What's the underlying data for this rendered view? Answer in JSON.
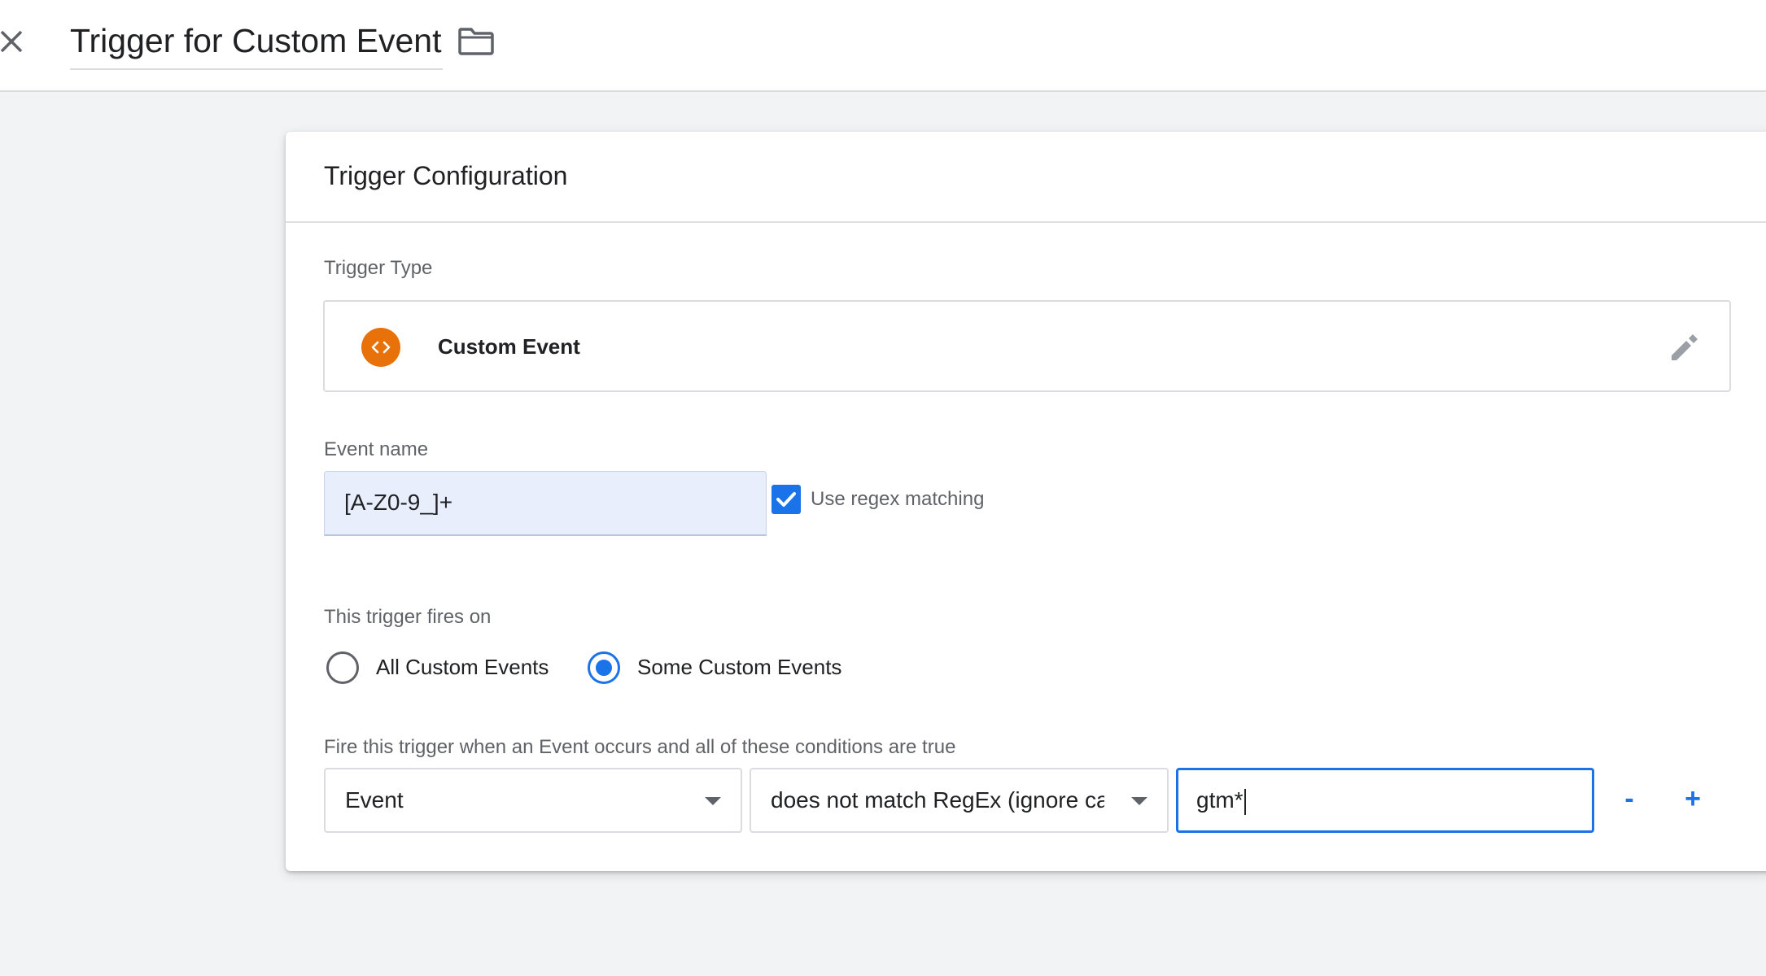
{
  "header": {
    "title": "Trigger for Custom Event"
  },
  "card": {
    "title": "Trigger Configuration",
    "trigger_type_label": "Trigger Type",
    "trigger_type": {
      "name": "Custom Event",
      "icon": "code-brackets-icon",
      "icon_color": "#e8710a"
    },
    "event_name_label": "Event name",
    "event_name_value": "[A-Z0-9_]+",
    "regex": {
      "label": "Use regex matching",
      "checked": true
    },
    "fires_on_label": "This trigger fires on",
    "fires_on_options": [
      {
        "label": "All Custom Events",
        "selected": false
      },
      {
        "label": "Some Custom Events",
        "selected": true
      }
    ],
    "condition_label": "Fire this trigger when an Event occurs and all of these conditions are true",
    "condition": {
      "variable": "Event",
      "operator": "does not match RegEx (ignore ca",
      "value": "gtm*",
      "remove_label": "-",
      "add_label": "+"
    }
  },
  "colors": {
    "accent": "#1a73e8",
    "input_fill": "#e8eefc",
    "page_background": "#f1f3f4"
  }
}
